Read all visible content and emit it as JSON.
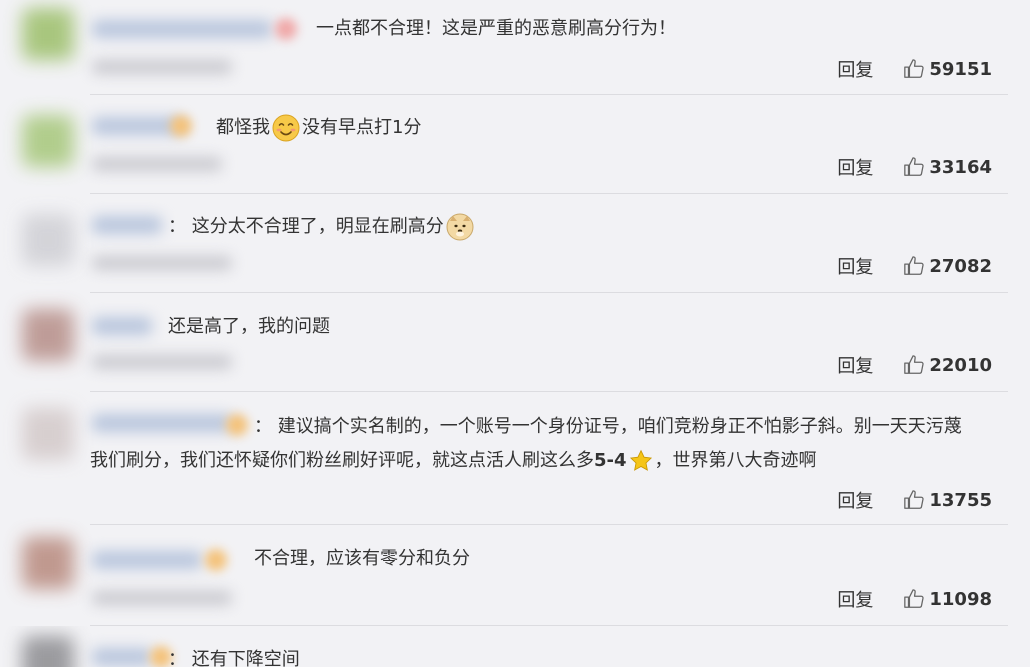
{
  "colors": {
    "background": "#f2f2f5",
    "text": "#333333",
    "divider": "#dcdce0"
  },
  "comments": [
    {
      "text_parts": [
        "一点都不合理！这是严重的恶意刷高分行为！"
      ],
      "reply_label": "回复",
      "likes": "59151"
    },
    {
      "text_parts": [
        "都怪我",
        "没有早点打1分"
      ],
      "emoji": "smile-emoji",
      "reply_label": "回复",
      "likes": "33164"
    },
    {
      "text_parts": [
        "：  这分太不合理了，明显在刷高分"
      ],
      "emoji": "doge-emoji",
      "reply_label": "回复",
      "likes": "27082"
    },
    {
      "text_parts": [
        "还是高了，我的问题"
      ],
      "reply_label": "回复",
      "likes": "22010"
    },
    {
      "text_parts": [
        "：  建议搞个实名制的，一个账号一个身份证号，咱们竞粉身正不怕影子斜。别一天天污蔑",
        "我们刷分，我们还怀疑你们粉丝刷好评呢，就这点活人刷这么多",
        "5-4",
        "，世界第八大奇迹啊"
      ],
      "emoji": "star-emoji",
      "reply_label": "回复",
      "likes": "13755"
    },
    {
      "text_parts": [
        "不合理，应该有零分和负分"
      ],
      "reply_label": "回复",
      "likes": "11098"
    },
    {
      "text_parts": [
        "：  还有下降空间"
      ]
    }
  ]
}
